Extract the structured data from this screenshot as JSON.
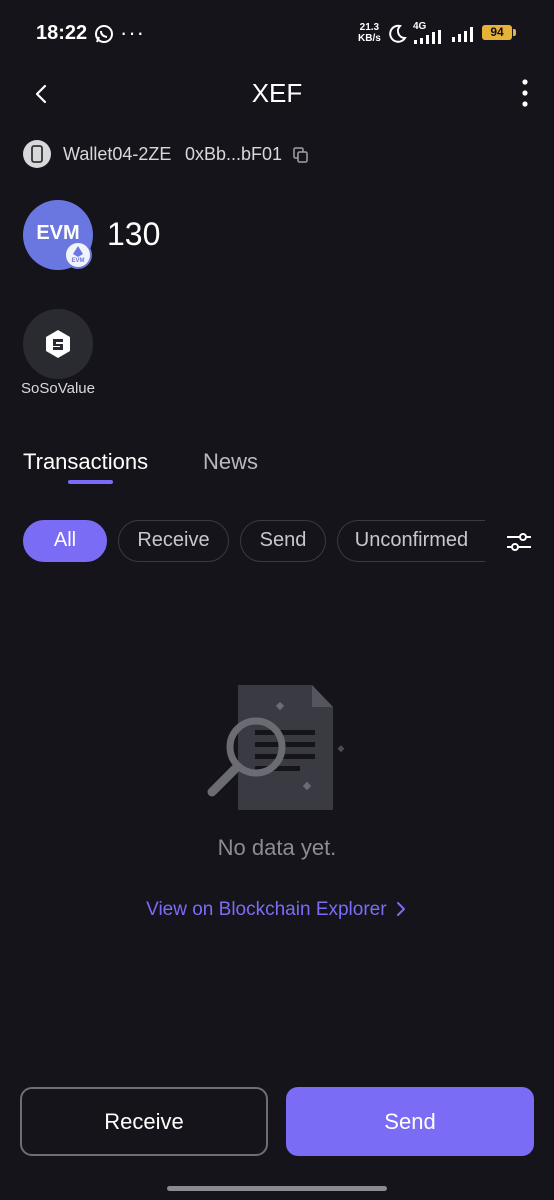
{
  "status_bar": {
    "time": "18:22",
    "more": "···",
    "net_speed_value": "21.3",
    "net_speed_unit": "KB/s",
    "network": "4G",
    "battery": "94"
  },
  "header": {
    "title": "XEF"
  },
  "wallet": {
    "name": "Wallet04-2ZE",
    "address": "0xBb...bF01"
  },
  "token": {
    "logo_text": "EVM",
    "badge_text": "EVM",
    "balance": "130"
  },
  "link_app": {
    "label": "SoSoValue"
  },
  "tabs": [
    {
      "label": "Transactions",
      "active": true
    },
    {
      "label": "News",
      "active": false
    }
  ],
  "filters": [
    {
      "label": "All",
      "active": true
    },
    {
      "label": "Receive",
      "active": false
    },
    {
      "label": "Send",
      "active": false
    },
    {
      "label": "Unconfirmed",
      "active": false
    }
  ],
  "empty": {
    "message": "No data yet.",
    "explorer_link": "View on Blockchain Explorer"
  },
  "actions": {
    "receive": "Receive",
    "send": "Send"
  },
  "colors": {
    "background": "#15141a",
    "accent": "#7b6cf6",
    "token_logo": "#6a77e0",
    "battery": "#e6b23a"
  },
  "icons": [
    "whatsapp-icon",
    "moon-icon",
    "signal-icon",
    "battery-icon",
    "back-arrow-icon",
    "more-vertical-icon",
    "phone-wallet-icon",
    "copy-icon",
    "sosovalue-icon",
    "filter-sliders-icon",
    "document-search-icon",
    "chevron-right-icon"
  ]
}
